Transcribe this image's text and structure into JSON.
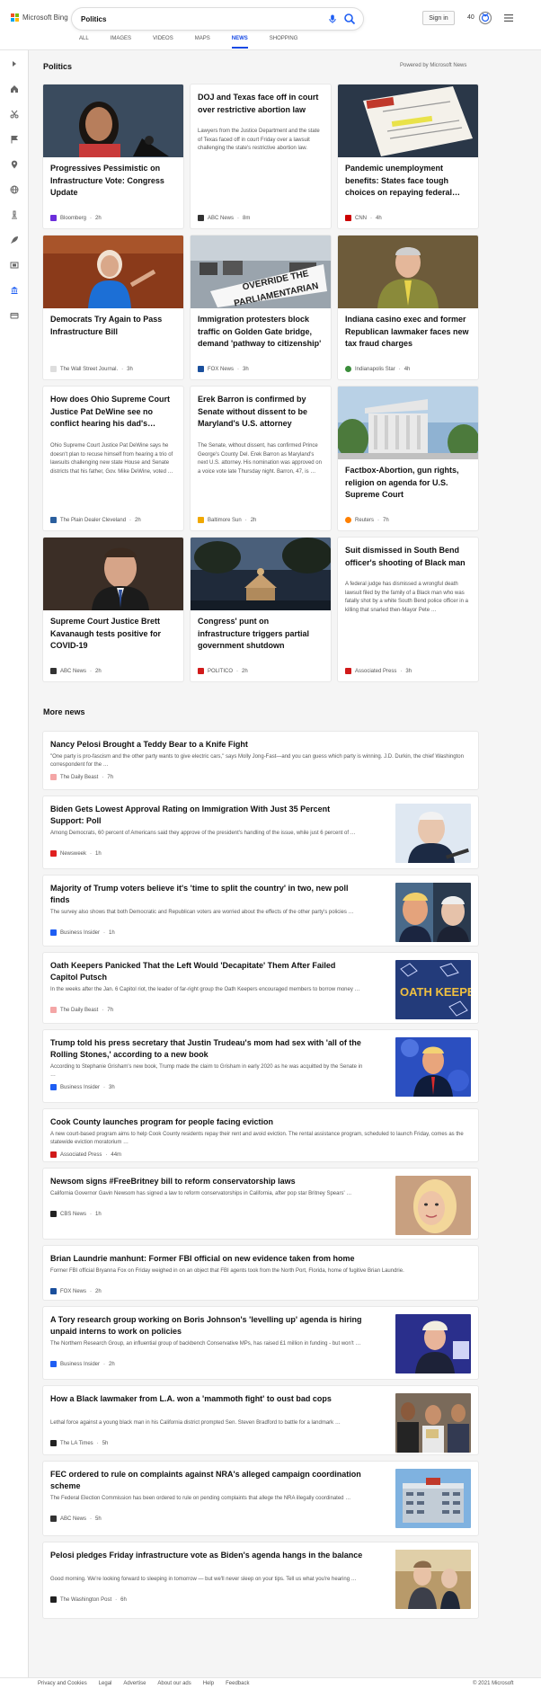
{
  "brand": {
    "name": "Microsoft Bing",
    "colors": [
      "#f25022",
      "#7fba00",
      "#00a4ef",
      "#ffb900"
    ]
  },
  "search": {
    "query": "Politics"
  },
  "header": {
    "signin_label": "Sign in",
    "rewards_count": "40"
  },
  "tabs": [
    {
      "label": "ALL"
    },
    {
      "label": "IMAGES"
    },
    {
      "label": "VIDEOS"
    },
    {
      "label": "MAPS"
    },
    {
      "label": "NEWS"
    },
    {
      "label": "SHOPPING"
    }
  ],
  "active_tab": "NEWS",
  "sidebar": {
    "icons": [
      "expand-icon",
      "home-icon",
      "scissors-icon",
      "flag-icon",
      "pin-icon",
      "globe-icon",
      "microscope-icon",
      "rocket-icon",
      "film-icon",
      "bank-icon",
      "card-icon"
    ]
  },
  "section": {
    "title": "Politics",
    "powered_by": "Powered by Microsoft News"
  },
  "cards": [
    {
      "title": "Progressives Pessimistic on Infrastructure Vote: Congress Update",
      "snippet": "",
      "source": "Bloomberg",
      "time": "2h",
      "logo_color": "#6b2ddb"
    },
    {
      "title": "DOJ and Texas face off in court over restrictive abortion law",
      "snippet": "Lawyers from the Justice Department and the state of Texas faced off in court Friday over a lawsuit challenging the state's restrictive abortion law.",
      "source": "ABC News",
      "time": "8m",
      "logo_color": "#333333"
    },
    {
      "title": "Pandemic unemployment benefits: States face tough choices on repaying federal…",
      "snippet": "",
      "source": "CNN",
      "time": "4h",
      "logo_color": "#cc0000"
    },
    {
      "title": "Democrats Try Again to Pass Infrastructure Bill",
      "snippet": "",
      "source": "The Wall Street Journal.",
      "time": "3h",
      "logo_color": "#888888"
    },
    {
      "title": "Immigration protesters block traffic on Golden Gate bridge, demand 'pathway to citizenship'",
      "snippet": "",
      "source": "FOX News",
      "time": "3h",
      "logo_color": "#1a4f9c"
    },
    {
      "title": "Indiana casino exec and former Republican lawmaker faces new tax fraud charges",
      "snippet": "",
      "source": "Indianapolis Star",
      "time": "4h",
      "logo_color": "#3a8d3a"
    },
    {
      "title": "How does Ohio Supreme Court Justice Pat DeWine see no conflict hearing his dad's…",
      "snippet": "Ohio Supreme Court Justice Pat DeWine says he doesn't plan to recuse himself from hearing a trio of lawsuits challenging new state House and Senate districts that his father, Gov. Mike DeWine, voted …",
      "source": "The Plain Dealer Cleveland",
      "time": "2h",
      "logo_color": "#2b5f9e"
    },
    {
      "title": "Erek Barron is confirmed by Senate without dissent to be Maryland's U.S. attorney",
      "snippet": "The Senate, without dissent, has confirmed Prince George's County Del. Erek Barron as Maryland's next U.S. attorney. His nomination was approved on a voice vote late Thursday night. Barron, 47, is …",
      "source": "Baltimore Sun",
      "time": "2h",
      "logo_color": "#f0a800"
    },
    {
      "title": "Factbox-Abortion, gun rights, religion on agenda for U.S. Supreme Court",
      "snippet": "",
      "source": "Reuters",
      "time": "7h",
      "logo_color": "#ff8000"
    },
    {
      "title": "Supreme Court Justice Brett Kavanaugh tests positive for COVID-19",
      "snippet": "",
      "source": "ABC News",
      "time": "2h",
      "logo_color": "#333333"
    },
    {
      "title": "Congress' punt on infrastructure triggers partial government shutdown",
      "snippet": "",
      "source": "POLITICO",
      "time": "2h",
      "logo_color": "#d11a1a"
    },
    {
      "title": "Suit dismissed in South Bend officer's shooting of Black man",
      "snippet": "A federal judge has dismissed a wrongful death lawsuit filed by the family of a Black man who was fatally shot by a white South Bend police officer in a killing that snarled then-Mayor Pete …",
      "source": "Associated Press",
      "time": "3h",
      "logo_color": "#d11a1a"
    }
  ],
  "more_news": {
    "title": "More news",
    "items": [
      {
        "title": "Nancy Pelosi Brought a Teddy Bear to a Knife Fight",
        "snippet": "\"One party is pro-fascism and the other party wants to give electric cars,\" says Molly Jong-Fast—and you can guess which party is winning. J.D. Durkin, the chief Washington correspondent for the …",
        "source": "The Daily Beast",
        "time": "7h",
        "logo_color": "#f4a6a6",
        "has_image": false
      },
      {
        "title": "Biden Gets Lowest Approval Rating on Immigration With Just 35 Percent Support: Poll",
        "snippet": "Among Democrats, 60 percent of Americans said they approve of the president's handling of the issue, while just 6 percent of …",
        "source": "Newsweek",
        "time": "1h",
        "logo_color": "#e02020",
        "has_image": true
      },
      {
        "title": "Majority of Trump voters believe it's 'time to split the country' in two, new poll finds",
        "snippet": "The survey also shows that both Democratic and Republican voters are worried about the effects of the other party's policies …",
        "source": "Business Insider",
        "time": "1h",
        "logo_color": "#1e5ef3",
        "has_image": true
      },
      {
        "title": "Oath Keepers Panicked That the Left Would 'Decapitate' Them After Failed Capitol Putsch",
        "snippet": "In the weeks after the Jan. 6 Capitol riot, the leader of far-right group the Oath Keepers encouraged members to borrow money …",
        "source": "The Daily Beast",
        "time": "7h",
        "logo_color": "#f4a6a6",
        "has_image": true,
        "image_text": "OATH KEEPERS"
      },
      {
        "title": "Trump told his press secretary that Justin Trudeau's mom had sex with 'all of the Rolling Stones,' according to a new book",
        "snippet": "According to Stephanie Grisham's new book, Trump made the claim to Grisham in early 2020 as he was acquitted by the Senate in …",
        "source": "Business Insider",
        "time": "3h",
        "logo_color": "#1e5ef3",
        "has_image": true
      },
      {
        "title": "Cook County launches program for people facing eviction",
        "snippet": "A new court-based program aims to help Cook County residents repay their rent and avoid eviction. The rental assistance program, scheduled to launch Friday, comes as the statewide eviction moratorium …",
        "source": "Associated Press",
        "time": "44m",
        "logo_color": "#d11a1a",
        "has_image": false
      },
      {
        "title": "Newsom signs #FreeBritney bill to reform conservatorship laws",
        "snippet": "California Governor Gavin Newsom has signed a law to reform conservatorships in California, after pop star Britney Spears' …",
        "source": "CBS News",
        "time": "1h",
        "logo_color": "#222222",
        "has_image": true
      },
      {
        "title": "Brian Laundrie manhunt: Former FBI official on new evidence taken from home",
        "snippet": "Former FBI official Bryanna Fox on Friday weighed in on an object that FBI agents took from the North Port, Florida, home of fugitive Brian Laundrie.",
        "source": "FOX News",
        "time": "2h",
        "logo_color": "#1a4f9c",
        "has_image": false
      },
      {
        "title": "A Tory research group working on Boris Johnson's 'levelling up' agenda is hiring unpaid interns to work on policies",
        "snippet": "The Northern Research Group, an influential group of backbench Conservative MPs, has raised £1 million in funding - but won't …",
        "source": "Business Insider",
        "time": "2h",
        "logo_color": "#1e5ef3",
        "has_image": true
      },
      {
        "title": "How a Black lawmaker from L.A. won a 'mammoth fight' to oust bad cops",
        "snippet": "Lethal force against a young black man in his California district prompted Sen. Steven Bradford to battle for a landmark …",
        "source": "The LA Times",
        "time": "5h",
        "logo_color": "#222222",
        "has_image": true
      },
      {
        "title": "FEC ordered to rule on complaints against NRA's alleged campaign coordination scheme",
        "snippet": "The Federal Election Commission has been ordered to rule on pending complaints that allege the NRA illegally coordinated …",
        "source": "ABC News",
        "time": "5h",
        "logo_color": "#333333",
        "has_image": true
      },
      {
        "title": "Pelosi pledges Friday infrastructure vote as Biden's agenda hangs in the balance",
        "snippet": "Good morning. We're looking forward to sleeping in tomorrow — but we'll never sleep on your tips. Tell us what you're hearing …",
        "source": "The Washington Post",
        "time": "6h",
        "logo_color": "#222222",
        "has_image": true
      }
    ]
  },
  "footer": {
    "links": [
      "Privacy and Cookies",
      "Legal",
      "Advertise",
      "About our ads",
      "Help",
      "Feedback"
    ],
    "copyright": "© 2021 Microsoft"
  }
}
